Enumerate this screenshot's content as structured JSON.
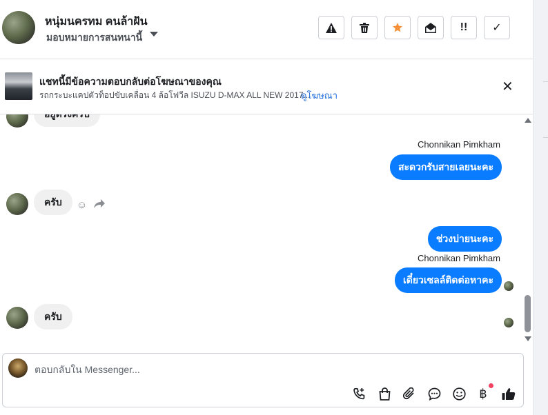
{
  "header": {
    "contact_name": "หนุ่มนครทม คนล้าฝัน",
    "assign_label": "มอบหมายการสนทนานี้",
    "toolbar": [
      {
        "name": "report-spam-button",
        "icon": "warning-icon",
        "glyph": "▲"
      },
      {
        "name": "delete-button",
        "icon": "trash-icon",
        "glyph": "🗑"
      },
      {
        "name": "star-button",
        "icon": "star-icon",
        "glyph": "★"
      },
      {
        "name": "mark-unread-button",
        "icon": "open-envelope-icon",
        "glyph": "✉"
      },
      {
        "name": "follow-up-button",
        "icon": "follow-up-icon",
        "glyph": "!!"
      },
      {
        "name": "mark-done-button",
        "icon": "check-icon",
        "glyph": "✓"
      }
    ]
  },
  "ad_banner": {
    "title": "แชทนี้มีข้อความตอบกลับต่อโฆษณาของคุณ",
    "description": "รถกระบะแคปตัวท็อปขับเคลื่อน 4 ล้อโฟวีล ISUZU D-MAX ALL NEW 2017...",
    "link": "ดูโฆษณา",
    "close": "✕"
  },
  "messages": [
    {
      "from": "customer",
      "text": "อยู่ตรงครับ"
    },
    {
      "from": "page",
      "sender": "Chonnikan Pimkham",
      "text": "สะดวกรับสายเลยนะคะ"
    },
    {
      "from": "customer",
      "text": "ครับ"
    },
    {
      "from": "page",
      "text": "ช่วงบ่ายนะคะ"
    },
    {
      "from": "page",
      "sender": "Chonnikan Pimkham",
      "text": "เดี๋ยวเซลล์ติดต่อหาคะ"
    },
    {
      "from": "customer",
      "text": "ครับ"
    }
  ],
  "message_actions": {
    "react_icon": "smiley-icon",
    "react_glyph": "☺",
    "reply_icon": "reply-icon",
    "reply_glyph": "➦"
  },
  "composer": {
    "placeholder": "ตอบกลับใน Messenger...",
    "icons": [
      {
        "name": "call-button",
        "icon": "phone-plus-icon",
        "glyph": "☏"
      },
      {
        "name": "shop-button",
        "icon": "shopping-bag-icon",
        "glyph": "👜"
      },
      {
        "name": "attach-button",
        "icon": "paperclip-icon",
        "glyph": "📎"
      },
      {
        "name": "saved-replies-button",
        "icon": "chat-bubble-icon",
        "glyph": "💬"
      },
      {
        "name": "emoji-button",
        "icon": "smiley-icon",
        "glyph": "☺"
      },
      {
        "name": "payment-button",
        "icon": "baht-icon",
        "glyph": "฿"
      },
      {
        "name": "like-button",
        "icon": "thumbs-up-icon",
        "glyph": "👍"
      }
    ]
  },
  "colors": {
    "outgoing_bubble": "#0a7cff",
    "incoming_bubble": "#f0f0f0",
    "link": "#216fdb",
    "star": "#f7923b",
    "notification_dot": "#f3425f"
  }
}
